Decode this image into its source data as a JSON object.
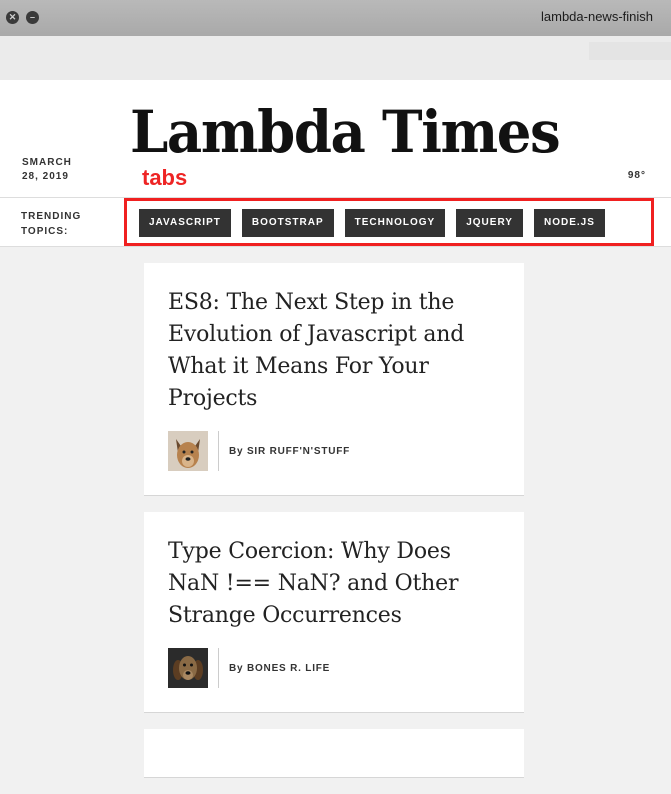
{
  "window": {
    "title": "lambda-news-finish"
  },
  "header": {
    "title": "Lambda Times",
    "date": "SMARCH 28, 2019",
    "temp": "98°"
  },
  "annotation": "tabs",
  "topics": {
    "title": "TRENDING TOPICS:",
    "tabs": [
      "JAVASCRIPT",
      "BOOTSTRAP",
      "TECHNOLOGY",
      "JQUERY",
      "NODE.JS"
    ]
  },
  "cards": [
    {
      "headline": "ES8: The Next Step in the Evolution of Javascript and What it Means For Your Projects",
      "author": "By SIR RUFF'N'STUFF"
    },
    {
      "headline": "Type Coercion: Why Does NaN !== NaN? and Other Strange Occurrences",
      "author": "By BONES R. LIFE"
    }
  ]
}
